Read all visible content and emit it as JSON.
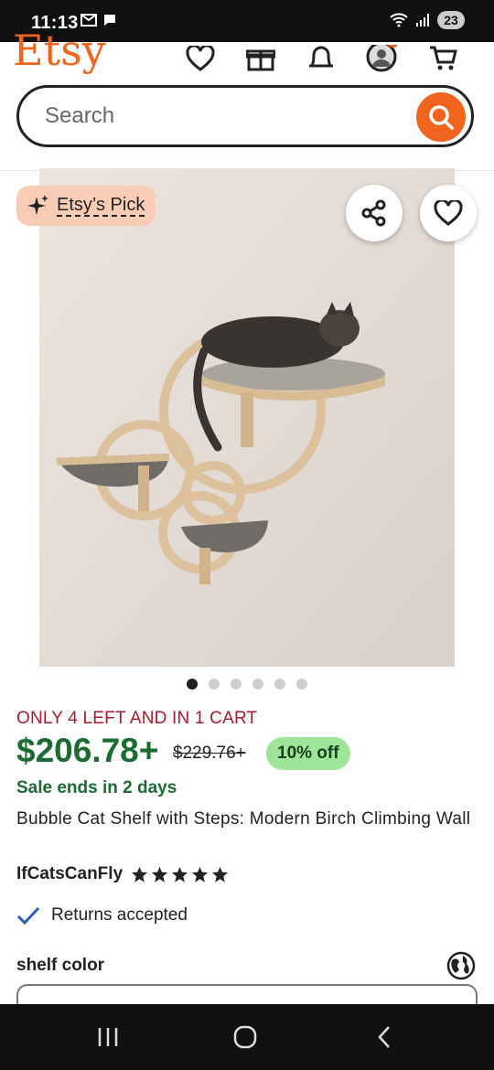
{
  "status_bar": {
    "time": "11:13",
    "battery": "23"
  },
  "header": {
    "logo": "Etsy",
    "brand_color": "#F1641E",
    "icons": [
      "heart-icon",
      "gift-icon",
      "bell-icon",
      "account-icon",
      "cart-icon"
    ]
  },
  "search": {
    "placeholder": "Search",
    "value": ""
  },
  "listing": {
    "badge": "Etsy’s Pick",
    "image_dots": 6,
    "active_image": 1,
    "stock_notice": "ONLY 4 LEFT AND IN 1 CART",
    "price": "$206.78+",
    "original_price": "$229.76+",
    "discount": "10% off",
    "sale_ends": "Sale ends in 2 days",
    "title": "Bubble Cat Shelf with Steps: Modern Birch Climbing Wall",
    "shop_name": "IfCatsCanFly",
    "rating": 5,
    "returns": "Returns accepted",
    "variation_label": "shelf color"
  },
  "colors": {
    "price_green": "#1C6B33",
    "stock_red": "#A61A2E",
    "discount_bg": "#9EE59A",
    "badge_bg": "#F9CDB5"
  }
}
